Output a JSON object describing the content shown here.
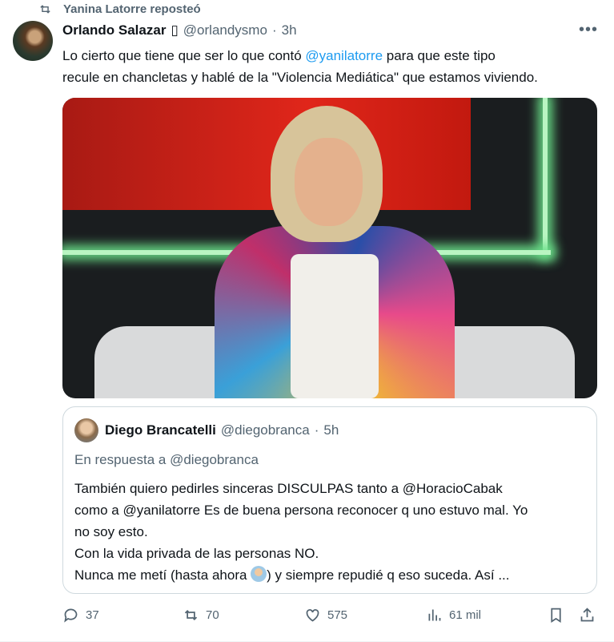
{
  "repost": {
    "text": "Yanina Latorre reposteó",
    "icon": "repost-icon"
  },
  "tweet": {
    "author_name": "Orlando Salazar",
    "author_badge": "▯",
    "handle": "@orlandysmo",
    "separator": "·",
    "time": "3h",
    "text_part1": "Lo cierto que tiene que ser lo que contó ",
    "mention": "@yanilatorre",
    "text_part2": " para que este tipo",
    "text_line2": "recule en chancletas y hablé de la \"Violencia Mediática\" que estamos viviendo."
  },
  "quoted": {
    "author_name": "Diego Brancatelli",
    "handle": "@diegobranca",
    "separator": "·",
    "time": "5h",
    "reply_to": "En respuesta a @diegobranca",
    "lines": [
      "También quiero pedirles sinceras DISCULPAS tanto a @HoracioCabak",
      "como a @yanilatorre Es de buena persona reconocer q uno estuvo mal. Yo",
      "no soy esto.",
      "Con la vida privada de las personas NO."
    ],
    "last_line_part1": "Nunca me metí (hasta ahora ",
    "last_line_part2": ") y siempre repudié q eso suceda. Así ..."
  },
  "actions": {
    "replies": "37",
    "reposts": "70",
    "likes": "575",
    "views": "61 mil"
  },
  "colors": {
    "accent": "#1d9bf0",
    "secondary_text": "#536471",
    "primary_text": "#0f1419",
    "border": "#cfd9de"
  }
}
